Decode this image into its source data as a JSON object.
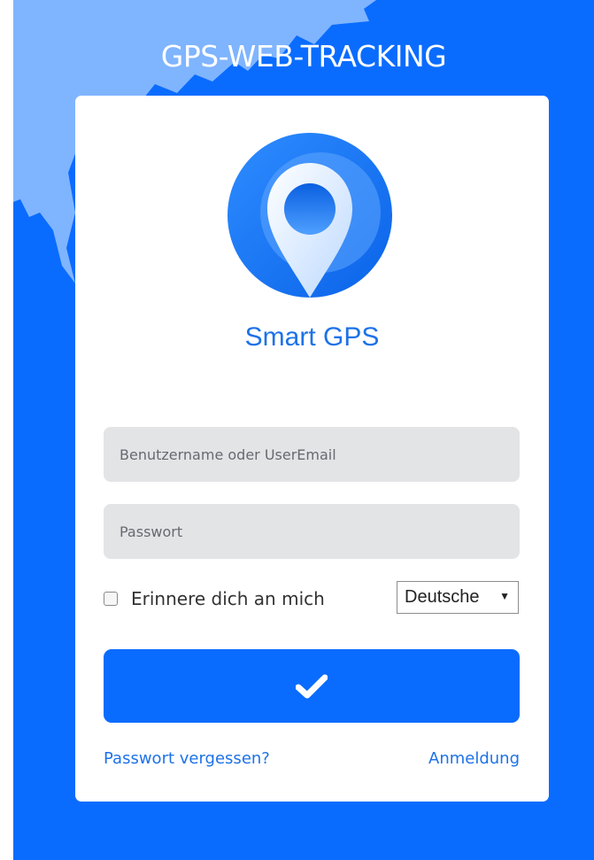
{
  "header": {
    "title": "GPS-WEB-TRACKING"
  },
  "brand": {
    "name": "Smart GPS",
    "logo_icon": "location-pin-icon"
  },
  "form": {
    "username_placeholder": "Benutzername oder UserEmail",
    "password_placeholder": "Passwort",
    "remember_label": "Erinnere dich an mich",
    "remember_checked": false,
    "language_selected": "Deutsche",
    "submit_icon": "checkmark-icon",
    "forgot_password_link": "Passwort vergessen?",
    "register_link": "Anmeldung"
  },
  "colors": {
    "background": "#0a6cff",
    "brand_text": "#1d72e8",
    "field_bg": "#e3e4e6",
    "button": "#0a6cff"
  }
}
